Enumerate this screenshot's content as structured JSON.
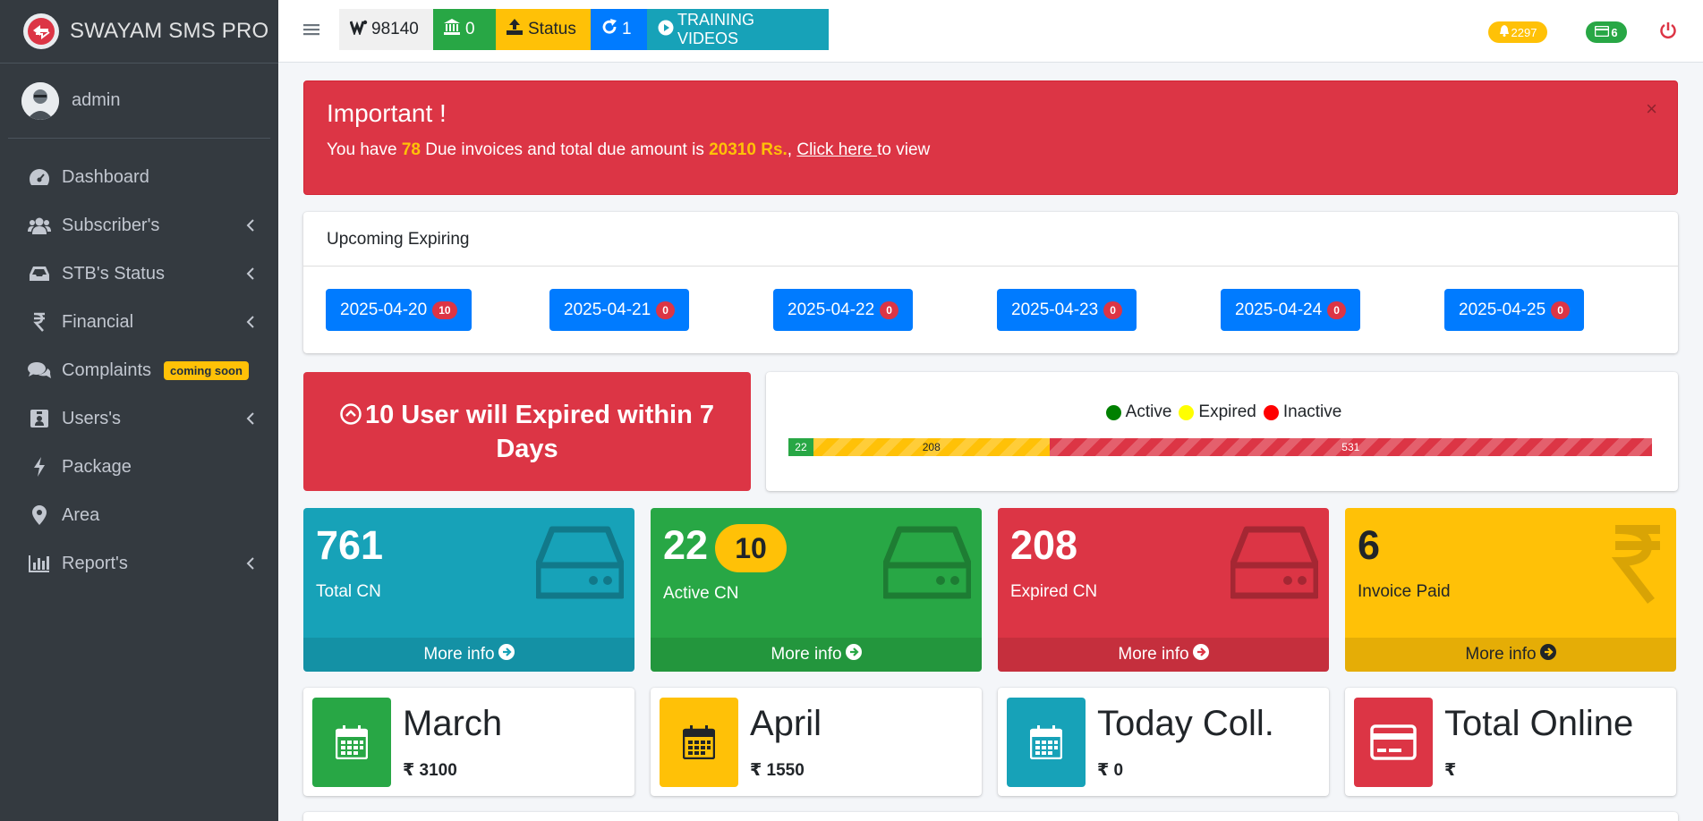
{
  "brand": {
    "name": "SWAYAM SMS PRO",
    "logo_icon": "brand-logo-icon"
  },
  "user": {
    "name": "admin"
  },
  "sidebar": {
    "items": [
      {
        "label": "Dashboard",
        "icon": "dashboard-icon",
        "chevron": false
      },
      {
        "label": "Subscriber's",
        "icon": "users-icon",
        "chevron": true
      },
      {
        "label": "STB's Status",
        "icon": "inbox-icon",
        "chevron": true
      },
      {
        "label": "Financial",
        "icon": "rupee-icon",
        "chevron": true
      },
      {
        "label": "Complaints",
        "icon": "comments-icon",
        "chevron": false,
        "badge": "coming soon"
      },
      {
        "label": "Users's",
        "icon": "user-id-icon",
        "chevron": true
      },
      {
        "label": "Package",
        "icon": "bolt-icon",
        "chevron": false
      },
      {
        "label": "Area",
        "icon": "map-pin-icon",
        "chevron": false
      },
      {
        "label": "Report's",
        "icon": "bar-chart-icon",
        "chevron": true
      }
    ]
  },
  "topbar": {
    "balance": "98140",
    "bank": "0",
    "status": "Status",
    "refresh": "1",
    "training": "TRAINING VIDEOS",
    "notifications": "2297",
    "cards": "6"
  },
  "alert": {
    "title": "Important !",
    "text_1": "You have ",
    "due_count": "78",
    "text_2": " Due invoices and total due amount is ",
    "due_amount": "20310 Rs.",
    "text_3": ", ",
    "link": "Click here ",
    "text_4": "to view",
    "close": "×"
  },
  "upcoming": {
    "title": "Upcoming Expiring",
    "dates": [
      {
        "date": "2025-04-20",
        "count": "10"
      },
      {
        "date": "2025-04-21",
        "count": "0"
      },
      {
        "date": "2025-04-22",
        "count": "0"
      },
      {
        "date": "2025-04-23",
        "count": "0"
      },
      {
        "date": "2025-04-24",
        "count": "0"
      },
      {
        "date": "2025-04-25",
        "count": "0"
      }
    ]
  },
  "expire_notice": "10 User will Expired within 7 Days",
  "status_bar": {
    "legend": [
      "Active",
      "Expired",
      "Inactive"
    ],
    "colors": {
      "active": "#28a745",
      "expired": "#ffc107",
      "inactive": "#dc3545"
    },
    "values": {
      "active": "22",
      "expired": "208",
      "inactive": "531"
    }
  },
  "stats": [
    {
      "value": "761",
      "label": "Total CN",
      "footer": "More info",
      "color": "#17a2b8",
      "icon": "hdd-icon"
    },
    {
      "value": "22",
      "badge": "10",
      "label": "Active CN",
      "footer": "More info",
      "color": "#28a745",
      "icon": "hdd-icon"
    },
    {
      "value": "208",
      "label": "Expired CN",
      "footer": "More info",
      "color": "#dc3545",
      "icon": "hdd-icon"
    },
    {
      "value": "6",
      "label": "Invoice Paid",
      "footer": "More info",
      "color": "#ffc107",
      "icon": "rupee-icon"
    }
  ],
  "info": [
    {
      "title": "March",
      "value": "3100",
      "color": "#28a745",
      "icon": "calendar-icon"
    },
    {
      "title": "April",
      "value": "1550",
      "color": "#ffc107",
      "icon": "calendar-icon"
    },
    {
      "title": "Today Coll.",
      "value": "0",
      "color": "#17a2b8",
      "icon": "calendar-icon"
    },
    {
      "title": "Total Online",
      "value": "",
      "color": "#dc3545",
      "icon": "credit-card-icon"
    }
  ],
  "currency_symbol": "₹"
}
